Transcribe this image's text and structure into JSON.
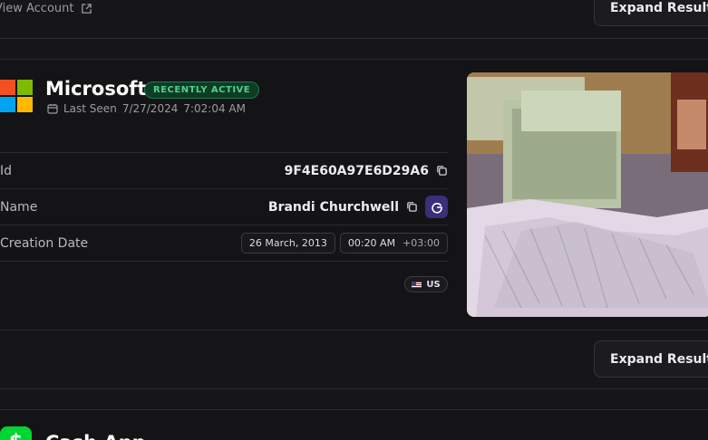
{
  "top": {
    "view_account": "View Account",
    "expand_label": "Expand Result"
  },
  "result": {
    "title": "Microsoft",
    "status_badge": "RECENTLY ACTIVE",
    "last_seen_label": "Last Seen",
    "last_seen_date": "7/27/2024",
    "last_seen_time": "7:02:04 AM",
    "rows": {
      "id": {
        "label": "Id",
        "value": "9F4E60A97E6D29A6"
      },
      "name": {
        "label": "Name",
        "value": "Brandi Churchwell"
      },
      "creation": {
        "label": "Creation Date",
        "date": "26 March, 2013",
        "time": "00:20 AM",
        "tz": "+03:00"
      }
    },
    "country": "US",
    "expand_label": "Expand Result"
  },
  "next": {
    "title": "Cash App",
    "icon_glyph": "$"
  },
  "icons": [
    "external-link-icon",
    "calendar-icon",
    "copy-icon",
    "google-icon",
    "us-flag-icon",
    "microsoft-logo",
    "cash-app-logo"
  ],
  "colors": {
    "background": "#161619",
    "badge_green": "#4fd18d",
    "google_button": "#3b2e7a",
    "cash_green": "#00d632"
  }
}
